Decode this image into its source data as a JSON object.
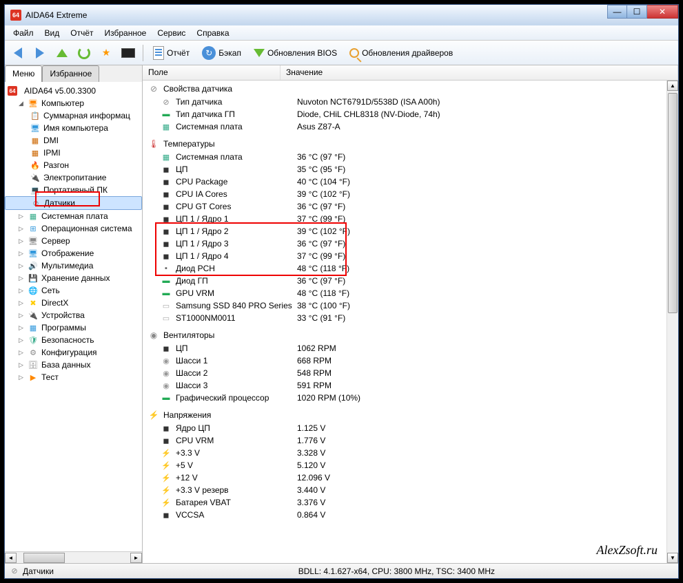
{
  "title": "AIDA64 Extreme",
  "app_badge": "64",
  "menubar": [
    "Файл",
    "Вид",
    "Отчёт",
    "Избранное",
    "Сервис",
    "Справка"
  ],
  "toolbar": {
    "report": "Отчёт",
    "backup": "Бэкап",
    "bios": "Обновления BIOS",
    "drivers": "Обновления драйверов"
  },
  "tabs": {
    "menu": "Меню",
    "fav": "Избранное"
  },
  "tree": {
    "root": "AIDA64 v5.00.3300",
    "computer": "Компьютер",
    "computer_children": [
      "Суммарная информац",
      "Имя компьютера",
      "DMI",
      "IPMI",
      "Разгон",
      "Электропитание",
      "Портативный ПК",
      "Датчики"
    ],
    "rest": [
      "Системная плата",
      "Операционная система",
      "Сервер",
      "Отображение",
      "Мультимедиа",
      "Хранение данных",
      "Сеть",
      "DirectX",
      "Устройства",
      "Программы",
      "Безопасность",
      "Конфигурация",
      "База данных",
      "Тест"
    ]
  },
  "columns": {
    "field": "Поле",
    "value": "Значение"
  },
  "sections": {
    "props": {
      "title": "Свойства датчика",
      "rows": [
        {
          "icon": "sensor",
          "field": "Тип датчика",
          "value": "Nuvoton NCT6791D/5538D  (ISA A00h)"
        },
        {
          "icon": "gpu",
          "field": "Тип датчика ГП",
          "value": "Diode, CHiL CHL8318  (NV-Diode, 74h)"
        },
        {
          "icon": "mb",
          "field": "Системная плата",
          "value": "Asus Z87-A"
        }
      ]
    },
    "temps": {
      "title": "Температуры",
      "rows": [
        {
          "icon": "mb",
          "field": "Системная плата",
          "value": "36 °C  (97 °F)"
        },
        {
          "icon": "cpu",
          "field": "ЦП",
          "value": "35 °C  (95 °F)"
        },
        {
          "icon": "cpu",
          "field": "CPU Package",
          "value": "40 °C  (104 °F)"
        },
        {
          "icon": "cpu",
          "field": "CPU IA Cores",
          "value": "39 °C  (102 °F)"
        },
        {
          "icon": "cpu",
          "field": "CPU GT Cores",
          "value": "36 °C  (97 °F)"
        },
        {
          "icon": "cpu",
          "field": "ЦП 1 / Ядро 1",
          "value": "37 °C  (99 °F)"
        },
        {
          "icon": "cpu",
          "field": "ЦП 1 / Ядро 2",
          "value": "39 °C  (102 °F)"
        },
        {
          "icon": "cpu",
          "field": "ЦП 1 / Ядро 3",
          "value": "36 °C  (97 °F)"
        },
        {
          "icon": "cpu",
          "field": "ЦП 1 / Ядро 4",
          "value": "37 °C  (99 °F)"
        },
        {
          "icon": "chip",
          "field": "Диод PCH",
          "value": "48 °C  (118 °F)"
        },
        {
          "icon": "gpu",
          "field": "Диод ГП",
          "value": "36 °C  (97 °F)"
        },
        {
          "icon": "gpu",
          "field": "GPU VRM",
          "value": "48 °C  (118 °F)"
        },
        {
          "icon": "disk",
          "field": "Samsung SSD 840 PRO Series",
          "value": "38 °C  (100 °F)"
        },
        {
          "icon": "disk",
          "field": "ST1000NM0011",
          "value": "33 °C  (91 °F)"
        }
      ]
    },
    "fans": {
      "title": "Вентиляторы",
      "rows": [
        {
          "icon": "cpu",
          "field": "ЦП",
          "value": "1062 RPM"
        },
        {
          "icon": "fan",
          "field": "Шасси 1",
          "value": "668 RPM"
        },
        {
          "icon": "fan",
          "field": "Шасси 2",
          "value": "548 RPM"
        },
        {
          "icon": "fan",
          "field": "Шасси 3",
          "value": "591 RPM"
        },
        {
          "icon": "gpu",
          "field": "Графический процессор",
          "value": "1020 RPM  (10%)"
        }
      ]
    },
    "volts": {
      "title": "Напряжения",
      "rows": [
        {
          "icon": "cpu",
          "field": "Ядро ЦП",
          "value": "1.125 V"
        },
        {
          "icon": "cpu",
          "field": "CPU VRM",
          "value": "1.776 V"
        },
        {
          "icon": "volt",
          "field": "+3.3 V",
          "value": "3.328 V"
        },
        {
          "icon": "volt",
          "field": "+5 V",
          "value": "5.120 V"
        },
        {
          "icon": "volt",
          "field": "+12 V",
          "value": "12.096 V"
        },
        {
          "icon": "volt",
          "field": "+3.3 V резерв",
          "value": "3.440 V"
        },
        {
          "icon": "volt",
          "field": "Батарея VBAT",
          "value": "3.376 V"
        },
        {
          "icon": "cpu",
          "field": "VCCSA",
          "value": "0.864 V"
        }
      ]
    }
  },
  "statusbar": {
    "left": "Датчики",
    "right": "BDLL: 4.1.627-x64, CPU: 3800 MHz, TSC: 3400 MHz"
  },
  "watermark": "AlexZsoft.ru"
}
